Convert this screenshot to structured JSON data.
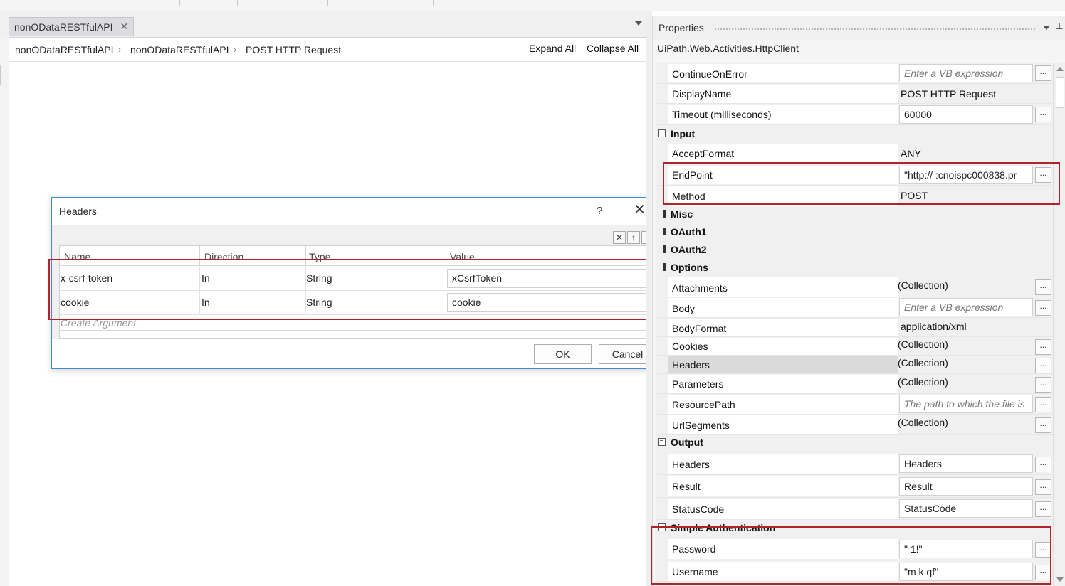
{
  "editor": {
    "tab_label": "nonODataRESTfulAPI",
    "tab_close": "✕",
    "breadcrumb": [
      "nonODataRESTfulAPI",
      "nonODataRESTfulAPI",
      "POST HTTP Request"
    ],
    "breadcrumb_sep": "›",
    "expand_all": "Expand All",
    "collapse_all": "Collapse All"
  },
  "dialog": {
    "title": "Headers",
    "help": "?",
    "close": "✕",
    "columns": [
      "Name",
      "Direction",
      "Type",
      "Value"
    ],
    "rows": [
      {
        "name": "x-csrf-token",
        "direction": "In",
        "type": "String",
        "value": "xCsrfToken"
      },
      {
        "name": "cookie",
        "direction": "In",
        "type": "String",
        "value": "cookie"
      }
    ],
    "create_argument": "Create Argument",
    "ok": "OK",
    "cancel": "Cancel",
    "toolbar_icons": [
      "delete-icon",
      "move-up-icon",
      "move-down-icon"
    ]
  },
  "properties": {
    "title": "Properties",
    "type_name": "UiPath.Web.Activities.HttpClient",
    "browse_label": "...",
    "common": [
      {
        "name": "ContinueOnError",
        "value": "Enter a VB expression",
        "placeholder": true
      },
      {
        "name": "DisplayName",
        "value": "POST HTTP Request"
      },
      {
        "name": "Timeout (milliseconds)",
        "value": "60000"
      }
    ],
    "input_label": "Input",
    "input": [
      {
        "name": "AcceptFormat",
        "value": "ANY"
      },
      {
        "name": "EndPoint",
        "value": "\"http://  :cnoispc000838.pr"
      },
      {
        "name": "Method",
        "value": "POST"
      }
    ],
    "collapsed": [
      "Misc",
      "OAuth1",
      "OAuth2"
    ],
    "options_label": "Options",
    "options": [
      {
        "name": "Attachments",
        "value": "(Collection)"
      },
      {
        "name": "Body",
        "value": "Enter a VB expression",
        "placeholder": true
      },
      {
        "name": "BodyFormat",
        "value": "application/xml"
      },
      {
        "name": "Cookies",
        "value": "(Collection)"
      },
      {
        "name": "Headers",
        "value": "(Collection)"
      },
      {
        "name": "Parameters",
        "value": "(Collection)"
      },
      {
        "name": "ResourcePath",
        "value": "The path to which the file is",
        "placeholder": true
      },
      {
        "name": "UrlSegments",
        "value": "(Collection)"
      }
    ],
    "output_label": "Output",
    "output": [
      {
        "name": "Headers",
        "value": "Headers"
      },
      {
        "name": "Result",
        "value": "Result"
      },
      {
        "name": "StatusCode",
        "value": "StatusCode"
      }
    ],
    "simple_auth_label": "Simple Authentication",
    "simple_auth": [
      {
        "name": "Password",
        "value": "\"            1!\""
      },
      {
        "name": "Username",
        "value": "\"m  k  qf\""
      }
    ],
    "toggle_expanded": "−"
  },
  "colors": {
    "highlight": "#b3222a",
    "dialog_border": "#3f8ad6"
  }
}
